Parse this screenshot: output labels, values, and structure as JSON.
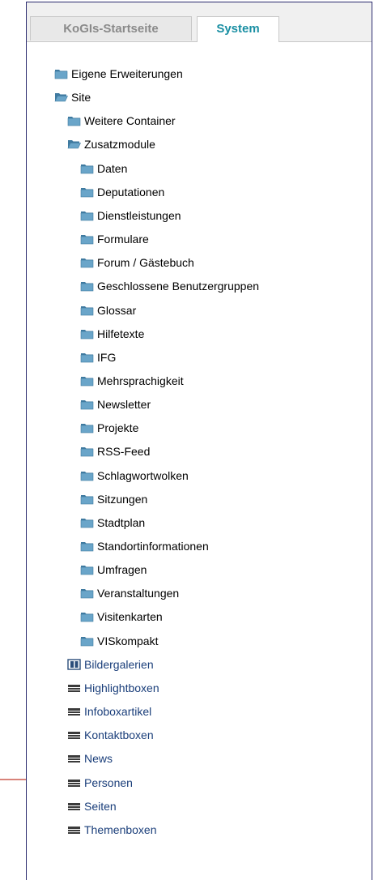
{
  "tabs": [
    {
      "label": "KoGIs-Startseite",
      "active": false
    },
    {
      "label": "System",
      "active": true
    }
  ],
  "tree": [
    {
      "label": "Eigene Erweiterungen",
      "level": 0,
      "icon": "folder-icon",
      "link": false
    },
    {
      "label": "Site",
      "level": 0,
      "icon": "folder-open-icon",
      "link": false
    },
    {
      "label": "Weitere Container",
      "level": 1,
      "icon": "folder-icon",
      "link": false
    },
    {
      "label": "Zusatzmodule",
      "level": 1,
      "icon": "folder-open-icon",
      "link": false
    },
    {
      "label": "Daten",
      "level": 2,
      "icon": "folder-icon",
      "link": false
    },
    {
      "label": "Deputationen",
      "level": 2,
      "icon": "folder-icon",
      "link": false
    },
    {
      "label": "Dienstleistungen",
      "level": 2,
      "icon": "folder-icon",
      "link": false
    },
    {
      "label": "Formulare",
      "level": 2,
      "icon": "folder-icon",
      "link": false
    },
    {
      "label": "Forum / Gästebuch",
      "level": 2,
      "icon": "folder-icon",
      "link": false
    },
    {
      "label": "Geschlossene Benutzergruppen",
      "level": 2,
      "icon": "folder-icon",
      "link": false
    },
    {
      "label": "Glossar",
      "level": 2,
      "icon": "folder-icon",
      "link": false
    },
    {
      "label": "Hilfetexte",
      "level": 2,
      "icon": "folder-icon",
      "link": false
    },
    {
      "label": "IFG",
      "level": 2,
      "icon": "folder-icon",
      "link": false
    },
    {
      "label": "Mehrsprachigkeit",
      "level": 2,
      "icon": "folder-icon",
      "link": false
    },
    {
      "label": "Newsletter",
      "level": 2,
      "icon": "folder-icon",
      "link": false
    },
    {
      "label": "Projekte",
      "level": 2,
      "icon": "folder-icon",
      "link": false
    },
    {
      "label": "RSS-Feed",
      "level": 2,
      "icon": "folder-icon",
      "link": false
    },
    {
      "label": "Schlagwortwolken",
      "level": 2,
      "icon": "folder-icon",
      "link": false
    },
    {
      "label": "Sitzungen",
      "level": 2,
      "icon": "folder-icon",
      "link": false
    },
    {
      "label": "Stadtplan",
      "level": 2,
      "icon": "folder-icon",
      "link": false
    },
    {
      "label": "Standortinformationen",
      "level": 2,
      "icon": "folder-icon",
      "link": false
    },
    {
      "label": "Umfragen",
      "level": 2,
      "icon": "folder-icon",
      "link": false
    },
    {
      "label": "Veranstaltungen",
      "level": 2,
      "icon": "folder-icon",
      "link": false
    },
    {
      "label": "Visitenkarten",
      "level": 2,
      "icon": "folder-icon",
      "link": false
    },
    {
      "label": "VISkompakt",
      "level": 2,
      "icon": "folder-icon",
      "link": false
    },
    {
      "label": "Bildergalerien",
      "level": 1,
      "icon": "gallery-icon",
      "link": true
    },
    {
      "label": "Highlightboxen",
      "level": 1,
      "icon": "box-icon",
      "link": true
    },
    {
      "label": "Infoboxartikel",
      "level": 1,
      "icon": "box-icon",
      "link": true
    },
    {
      "label": "Kontaktboxen",
      "level": 1,
      "icon": "box-icon",
      "link": true
    },
    {
      "label": "News",
      "level": 1,
      "icon": "box-icon",
      "link": true
    },
    {
      "label": "Personen",
      "level": 1,
      "icon": "box-icon",
      "link": true
    },
    {
      "label": "Seiten",
      "level": 1,
      "icon": "box-icon",
      "link": true
    },
    {
      "label": "Themenboxen",
      "level": 1,
      "icon": "box-icon",
      "link": true
    }
  ],
  "colors": {
    "folder": "#6aa5c9",
    "folder_dark": "#3f7aa0",
    "active_tab": "#1a8fa3",
    "link": "#1a3e7a",
    "frame": "#2a2a6e",
    "annotation_line": "#c0392b"
  }
}
